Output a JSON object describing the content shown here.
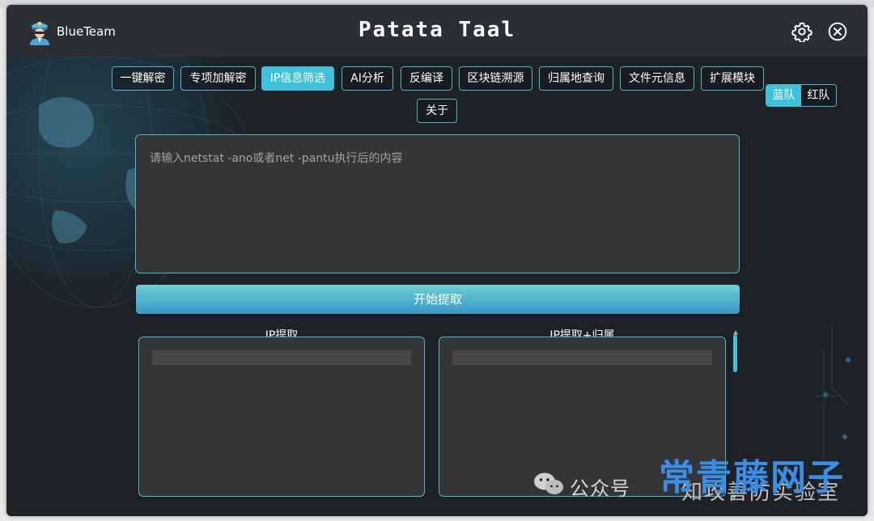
{
  "app": {
    "name": "BlueTeam",
    "title": "Patata Taal"
  },
  "nav": {
    "tabs": [
      {
        "label": "一键解密"
      },
      {
        "label": "专项加解密"
      },
      {
        "label": "IP信息筛选",
        "active": true
      },
      {
        "label": "AI分析"
      },
      {
        "label": "反编译"
      },
      {
        "label": "区块链溯源"
      },
      {
        "label": "归属地查询"
      },
      {
        "label": "文件元信息"
      },
      {
        "label": "扩展模块"
      },
      {
        "label": "关于"
      }
    ]
  },
  "team_toggle": {
    "options": [
      "蓝队",
      "红队"
    ],
    "selected": "蓝队"
  },
  "input": {
    "placeholder": "请输入netstat -ano或者net -pantu执行后的内容",
    "value": ""
  },
  "start_button": {
    "label": "开始提取"
  },
  "panels": [
    {
      "title": "IP提取"
    },
    {
      "title": "IP提取+归属"
    }
  ],
  "watermark": {
    "brand": "公众号",
    "name": "常青藤网子",
    "sub": "知攻善防实验室"
  },
  "colors": {
    "accent": "#3fc1d9",
    "border": "#48b8c4",
    "window_bg": "#1e2226",
    "titlebar_bg": "#2b2f33",
    "panel_bg": "#333537"
  }
}
